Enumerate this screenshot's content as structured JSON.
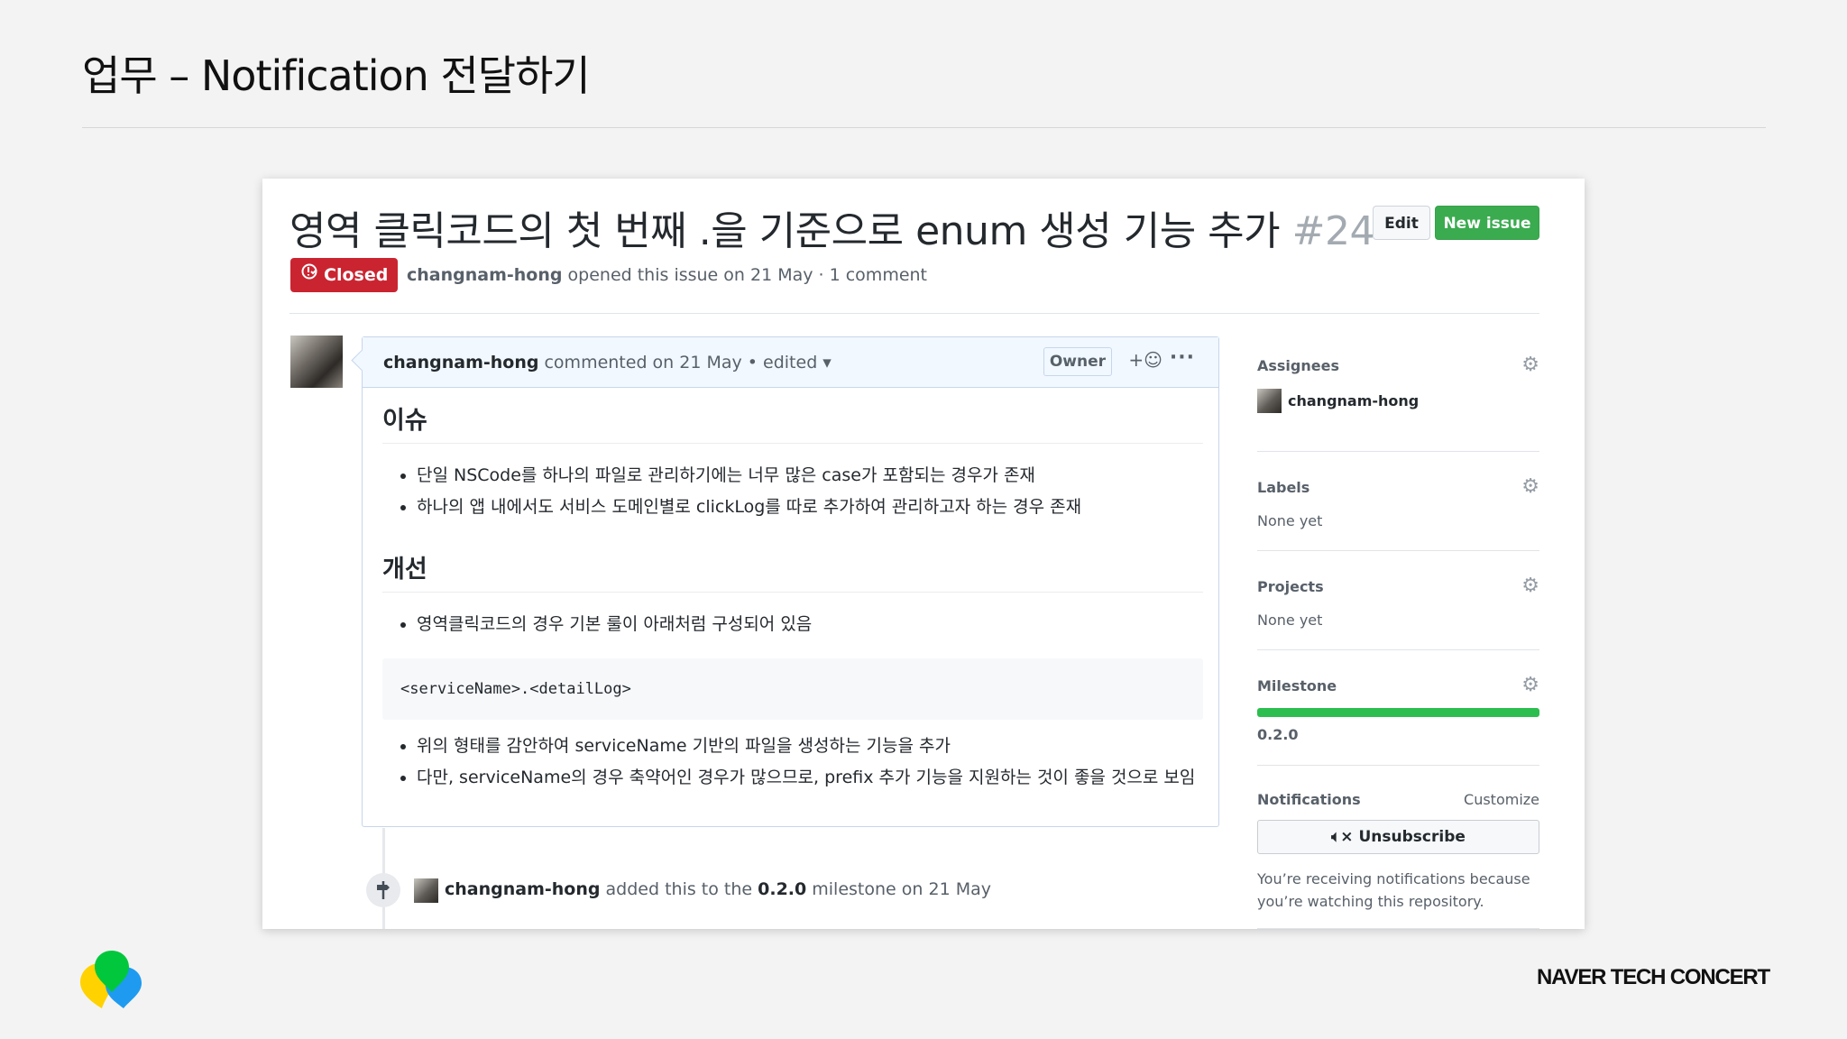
{
  "slide": {
    "title": "업무 – Notification 전달하기",
    "brand": "NAVER TECH CONCERT"
  },
  "issue": {
    "title": "영역 클릭코드의 첫 번째 .을 기준으로 enum 생성 기능 추가",
    "number": "#24",
    "edit_label": "Edit",
    "new_issue_label": "New issue",
    "state": "Closed",
    "author": "changnam-hong",
    "meta_text": " opened this issue on 21 May · 1 comment"
  },
  "comment": {
    "author": "changnam-hong",
    "meta": "commented on 21 May • edited ▾",
    "owner_label": "Owner",
    "reaction_label": "+☺",
    "more_label": "···",
    "heading1": "이슈",
    "issues": [
      "단일 NSCode를 하나의 파일로 관리하기에는 너무 많은 case가 포함되는 경우가 존재",
      "하나의 앱 내에서도 서비스 도메인별로 clickLog를 따로 추가하여 관리하고자 하는 경우 존재"
    ],
    "heading2": "개선",
    "improvements_a": [
      "영역클릭코드의 경우 기본 룰이 아래처럼 구성되어 있음"
    ],
    "code": "<serviceName>.<detailLog>",
    "improvements_b": [
      "위의 형태를 감안하여 serviceName 기반의 파일을 생성하는 기능을 추가",
      "다만, serviceName의 경우 축약어인 경우가 많으므로, prefix 추가 기능을 지원하는 것이 좋을 것으로 보임"
    ]
  },
  "event": {
    "author": "changnam-hong",
    "text_a": " added this to the ",
    "milestone": "0.2.0",
    "text_b": " milestone on 21 May"
  },
  "sidebar": {
    "assignees_label": "Assignees",
    "assignee": "changnam-hong",
    "labels_label": "Labels",
    "labels_value": "None yet",
    "projects_label": "Projects",
    "projects_value": "None yet",
    "milestone_label": "Milestone",
    "milestone_value": "0.2.0",
    "milestone_progress": 1.0,
    "notifications_label": "Notifications",
    "customize_label": "Customize",
    "unsubscribe_label": "Unsubscribe",
    "notice": "You’re receiving notifications because you’re watching this repository."
  },
  "colors": {
    "closed": "#cb2431",
    "new_issue": "#3bab50",
    "progress": "#2cbe4e"
  },
  "icons": [
    "closed-issue-icon",
    "gear-icon",
    "mute-icon",
    "milestone-icon",
    "smiley-icon",
    "kebab-icon"
  ]
}
